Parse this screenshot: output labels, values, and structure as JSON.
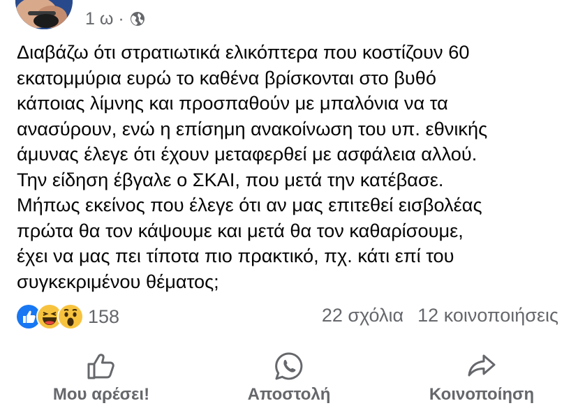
{
  "header": {
    "time": "1 ω",
    "separator": "·",
    "privacy_icon": "globe-icon"
  },
  "post": {
    "lines": [
      "Διαβάζω ότι στρατιωτικά ελικόπτερα που κοστίζουν 60",
      "εκατομμύρια ευρώ το καθένα βρίσκονται στο βυθό",
      "κάποιας λίμνης και προσπαθούν με μπαλόνια να τα",
      "ανασύρουν, ενώ η επίσημη ανακοίνωση του υπ. εθνικής",
      "άμυνας έλεγε ότι έχουν μεταφερθεί με ασφάλεια αλλού.",
      "Την είδηση έβγαλε ο ΣΚΑΙ, που μετά την κατέβασε.",
      "Μήπως εκείνος που έλεγε ότι αν μας επιτεθεί εισβολέας",
      "πρώτα θα τον κάψουμε και μετά θα τον καθαρίσουμε,",
      "έχει να μας πει τίποτα πιο πρακτικό, πχ. κάτι επί του",
      "συγκεκριμένου θέματος;"
    ]
  },
  "stats": {
    "reactions": [
      "like",
      "haha",
      "wow"
    ],
    "reaction_count": "158",
    "comments": "22 σχόλια",
    "shares": "12 κοινοποιήσεις"
  },
  "actions": {
    "like_label": "Μου αρέσει!",
    "send_label": "Αποστολή",
    "share_label": "Κοινοποίηση"
  },
  "colors": {
    "secondary_text": "#65676b",
    "like_blue": "#1877f2",
    "emoji_yellow": "#f7c33f"
  }
}
